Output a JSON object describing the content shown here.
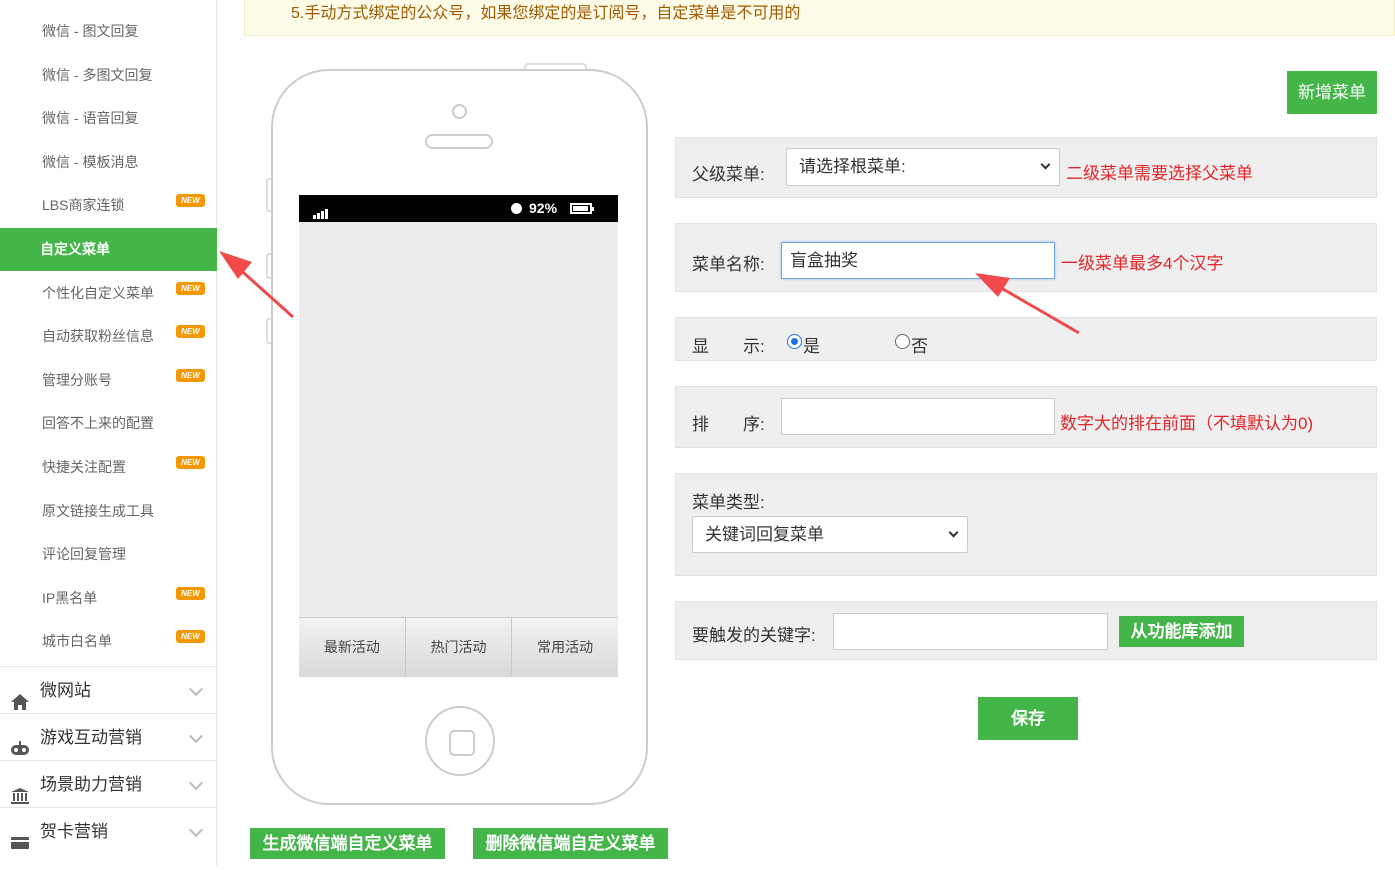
{
  "notice": {
    "text": "5.手动方式绑定的公众号，如果您绑定的是订阅号，自定菜单是不可用的"
  },
  "sidebar": {
    "sub_items": [
      {
        "label": "微信 - 图文回复",
        "new": false
      },
      {
        "label": "微信 - 多图文回复",
        "new": false
      },
      {
        "label": "微信 - 语音回复",
        "new": false
      },
      {
        "label": "微信 - 模板消息",
        "new": false
      },
      {
        "label": "LBS商家连锁",
        "new": true
      },
      {
        "label": "自定义菜单",
        "new": false,
        "active": true
      },
      {
        "label": "个性化自定义菜单",
        "new": true
      },
      {
        "label": "自动获取粉丝信息",
        "new": true
      },
      {
        "label": "管理分账号",
        "new": true
      },
      {
        "label": "回答不上来的配置",
        "new": false
      },
      {
        "label": "快捷关注配置",
        "new": true
      },
      {
        "label": "原文链接生成工具",
        "new": false
      },
      {
        "label": "评论回复管理",
        "new": false
      },
      {
        "label": "IP黑名单",
        "new": true
      },
      {
        "label": "城市白名单",
        "new": true
      }
    ],
    "new_badge": "NEW",
    "groups": [
      {
        "label": "微网站",
        "icon": "home-icon"
      },
      {
        "label": "游戏互动营销",
        "icon": "gamepad-icon"
      },
      {
        "label": "场景助力营销",
        "icon": "bank-icon"
      },
      {
        "label": "贺卡营销",
        "icon": "card-icon"
      }
    ]
  },
  "phone": {
    "battery": "92%",
    "menu": [
      "最新活动",
      "热门活动",
      "常用活动"
    ]
  },
  "buttons": {
    "add_menu": "新增菜单",
    "generate": "生成微信端自定义菜单",
    "delete": "删除微信端自定义菜单",
    "from_library": "从功能库添加",
    "save": "保存"
  },
  "form": {
    "parent": {
      "label": "父级菜单:",
      "value": "请选择根菜单:",
      "hint": "二级菜单需要选择父菜单"
    },
    "name": {
      "label": "菜单名称:",
      "value": "盲盒抽奖",
      "hint": "一级菜单最多4个汉字"
    },
    "display": {
      "label": "显　　示:",
      "yes": "是",
      "no": "否",
      "selected": "是"
    },
    "order": {
      "label": "排　　序:",
      "value": "",
      "hint": "数字大的排在前面（不填默认为0)"
    },
    "type": {
      "label": "菜单类型:",
      "value": "关键词回复菜单"
    },
    "keyword": {
      "label": "要触发的关键字:",
      "value": ""
    }
  },
  "colors": {
    "accent": "#44b549",
    "hint": "#e3262b",
    "arrow": "#f04a4a"
  }
}
